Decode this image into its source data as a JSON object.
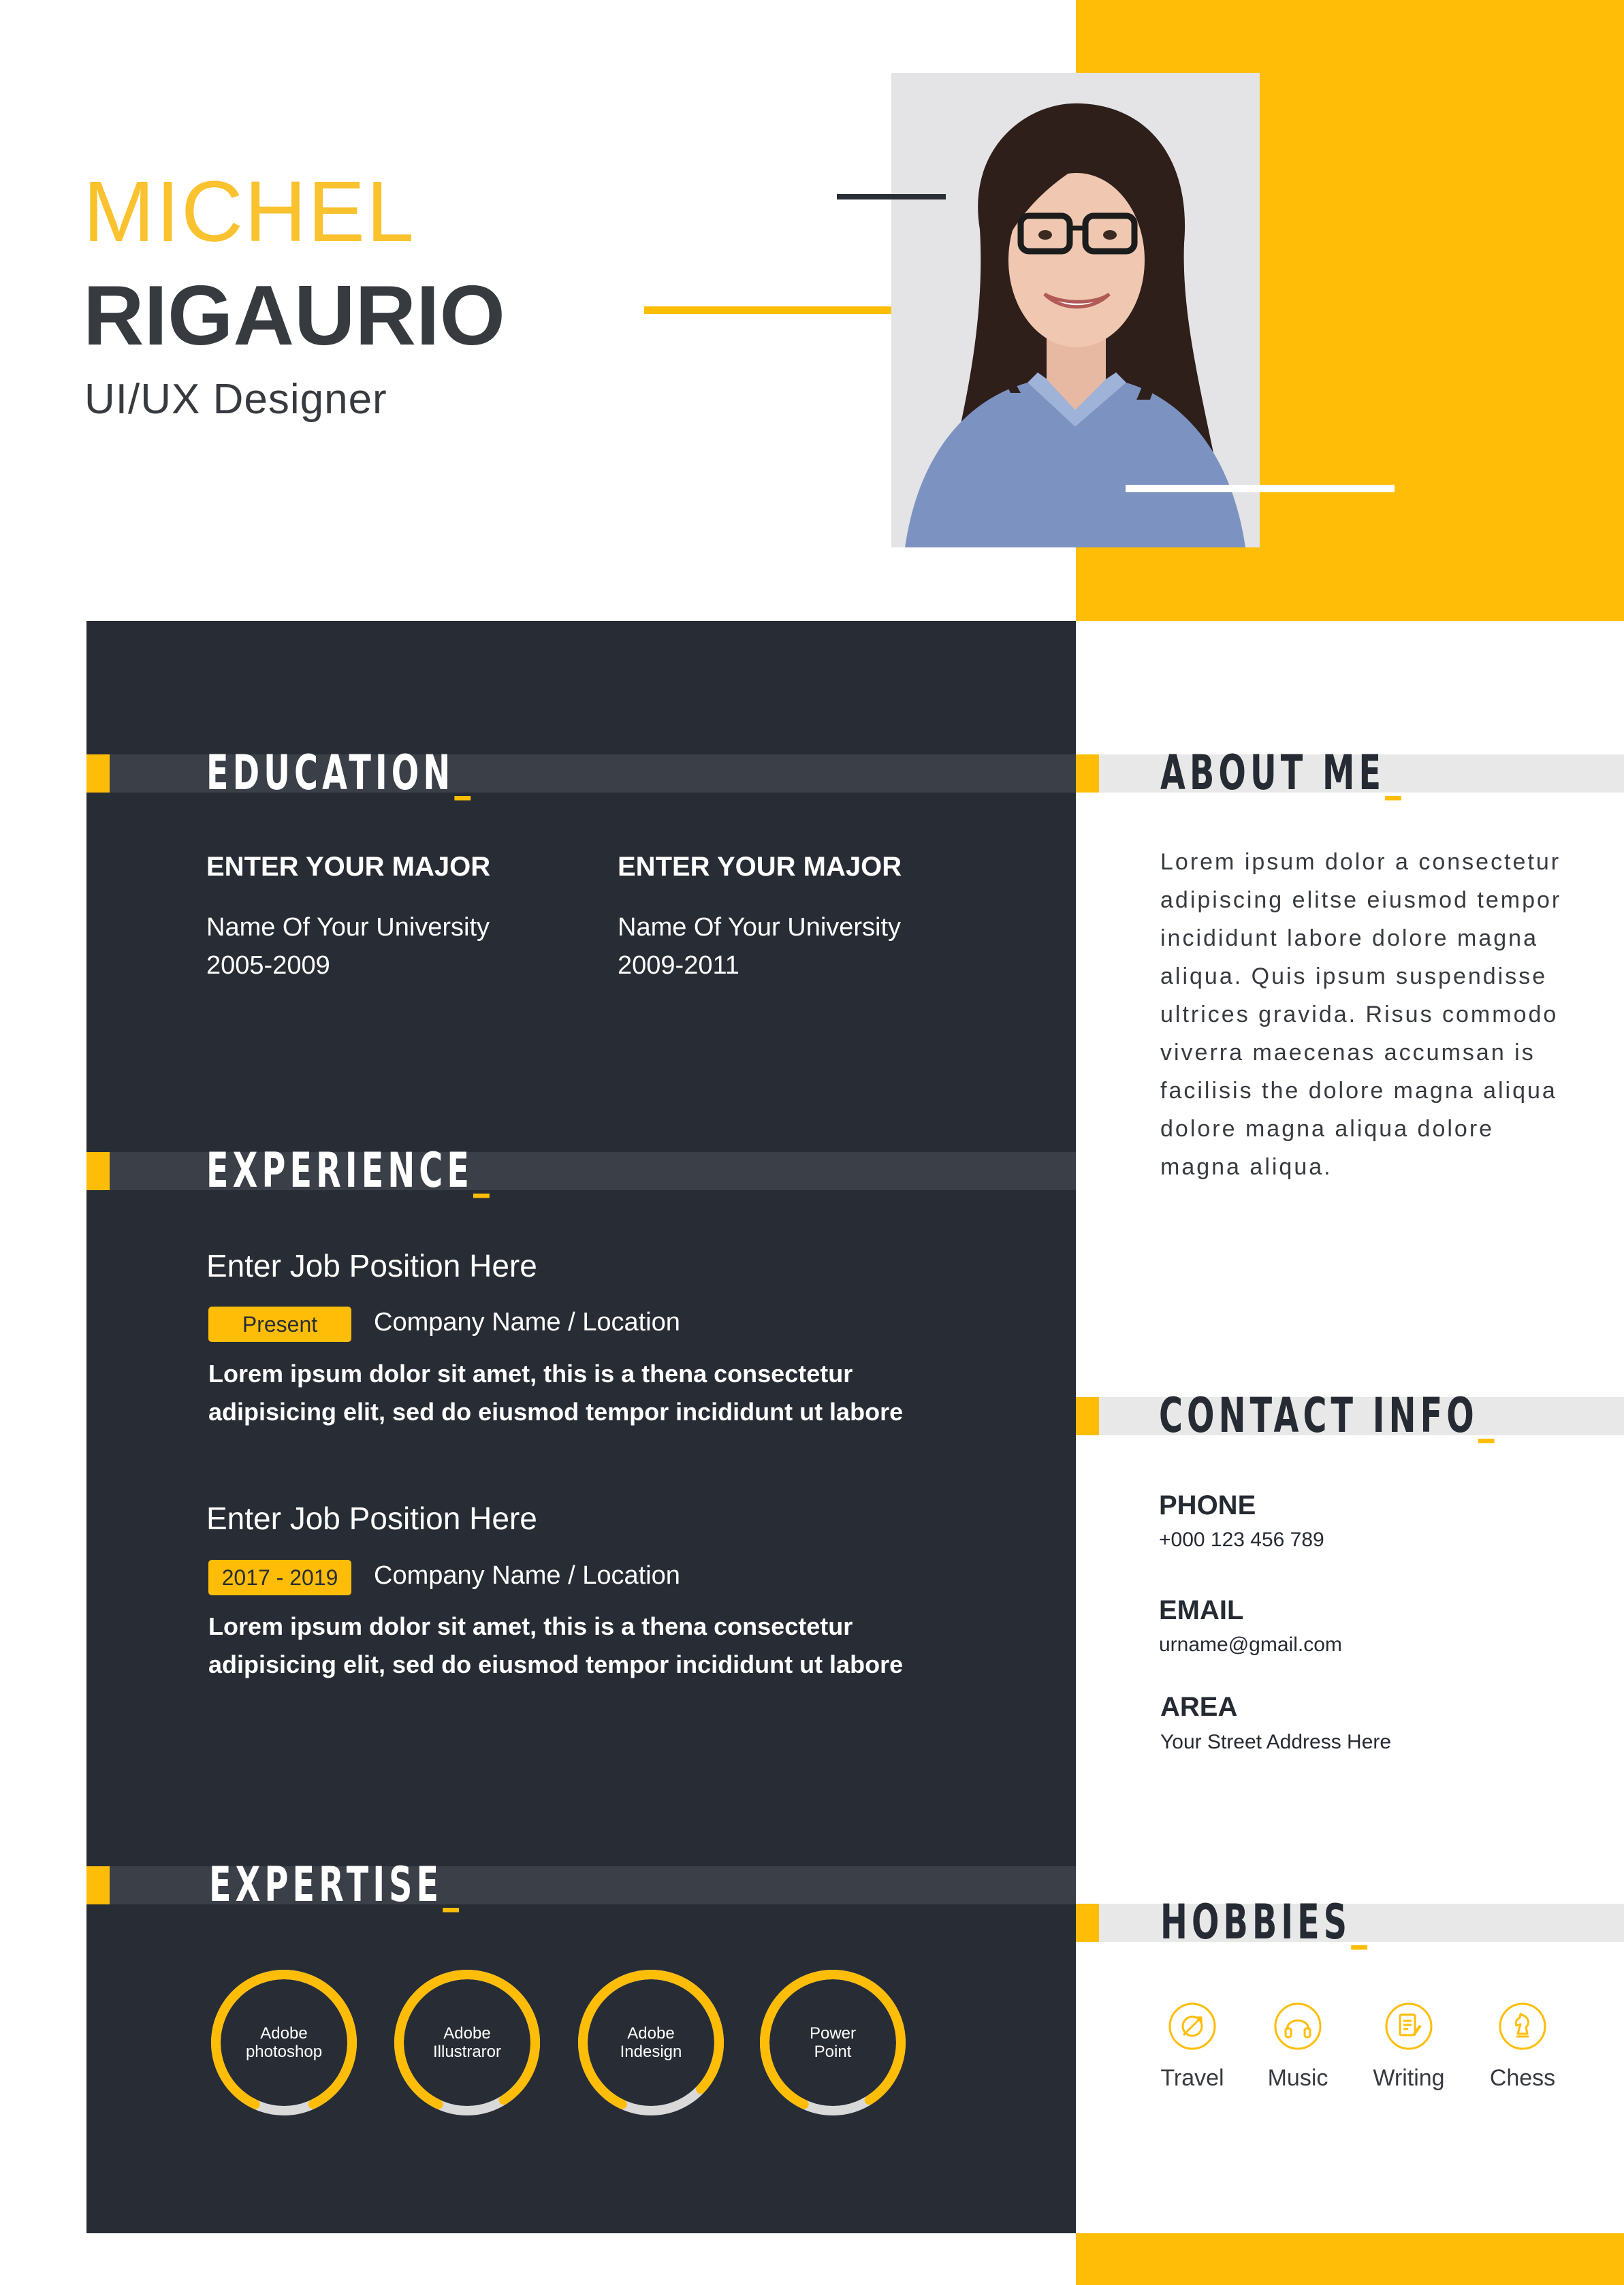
{
  "colors": {
    "accent": "#ffbd07",
    "dark": "#282d35",
    "text": "#373a3f"
  },
  "header": {
    "first_name": "MICHEL",
    "last_name": "RIGAURIO",
    "title": "UI/UX Designer"
  },
  "education": {
    "heading": "EDUCATION",
    "entries": [
      {
        "major": "ENTER YOUR MAJOR",
        "university": "Name Of Your University",
        "years": "2005-2009"
      },
      {
        "major": "ENTER YOUR MAJOR",
        "university": "Name Of Your University",
        "years": "2009-2011"
      }
    ]
  },
  "experience": {
    "heading": "EXPERIENCE",
    "jobs": [
      {
        "position": "Enter Job Position Here",
        "period": "Present",
        "company": "Company Name / Location",
        "description_line1": "Lorem ipsum dolor sit amet, this is a thena  consectetur",
        "description_line2": "adipisicing elit, sed do eiusmod tempor incididunt ut labore"
      },
      {
        "position": "Enter Job Position Here",
        "period": "2017 - 2019",
        "company": "Company Name / Location",
        "description_line1": "Lorem ipsum dolor sit amet, this is a thena  consectetur",
        "description_line2": "adipisicing elit, sed do eiusmod tempor incididunt ut labore"
      }
    ]
  },
  "expertise": {
    "heading": "EXPERTISE",
    "skills": [
      {
        "line1": "Adobe",
        "line2": "photoshop",
        "level": 0.86
      },
      {
        "line1": "Adobe",
        "line2": "Illustraror",
        "level": 0.84
      },
      {
        "line1": "Adobe",
        "line2": "Indesign",
        "level": 0.8
      },
      {
        "line1": "Power",
        "line2": "Point",
        "level": 0.84
      }
    ]
  },
  "about": {
    "heading": "ABOUT ME",
    "text": "Lorem ipsum dolor a consectetur adipiscing elitse eiusmod tempor incididunt labore dolore magna aliqua. Quis ipsum suspendisse ultrices gravida. Risus commodo viverra maecenas accumsan is facilisis the dolore magna aliqua dolore magna aliqua dolore magna aliqua."
  },
  "contact": {
    "heading": "CONTACT INFO",
    "phone_label": "PHONE",
    "phone": "+000 123 456 789",
    "email_label": "EMAIL",
    "email": "urname@gmail.com",
    "area_label": "AREA",
    "area": "Your Street Address Here"
  },
  "hobbies": {
    "heading": "HOBBIES",
    "items": [
      {
        "label": "Travel",
        "icon": "travel-icon"
      },
      {
        "label": "Music",
        "icon": "headphones-icon"
      },
      {
        "label": "Writing",
        "icon": "writing-icon"
      },
      {
        "label": "Chess",
        "icon": "chess-knight-icon"
      }
    ]
  }
}
